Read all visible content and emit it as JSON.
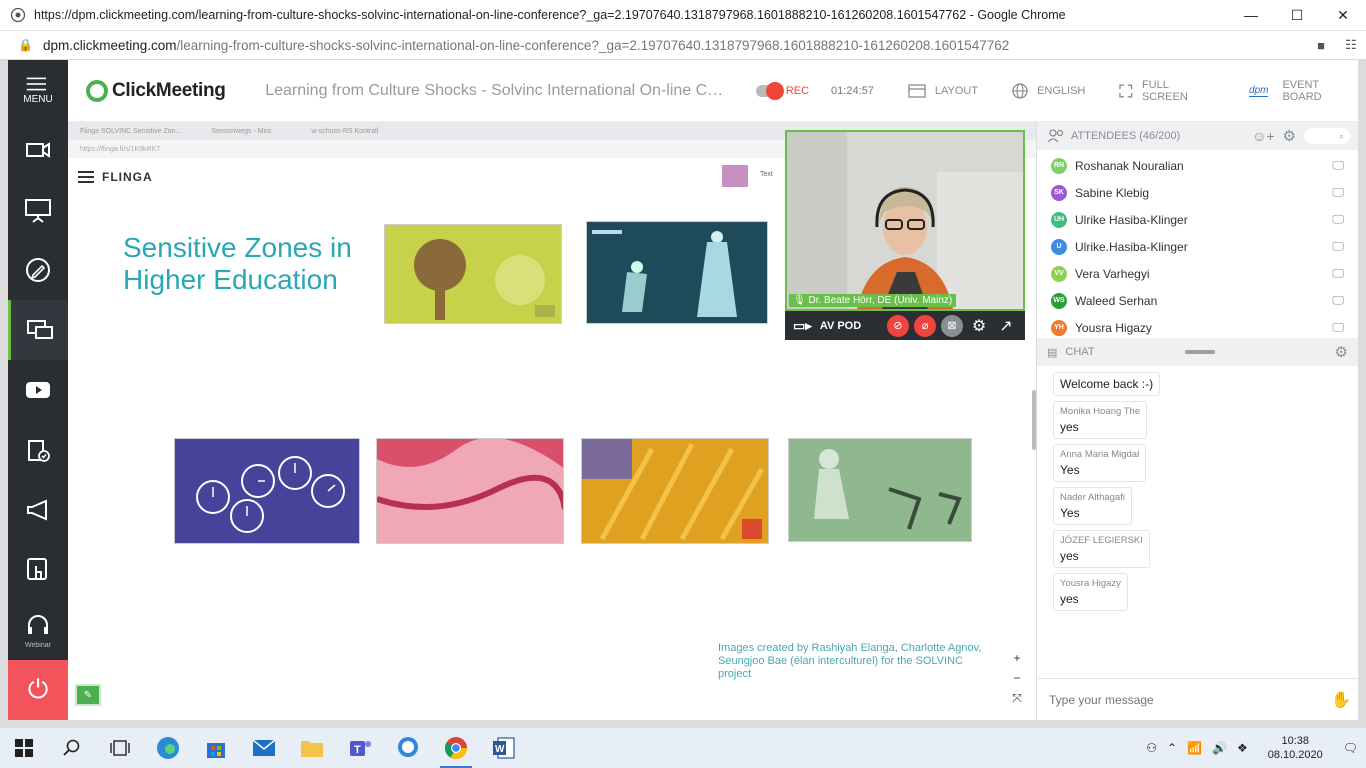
{
  "browser": {
    "title": "https://dpm.clickmeeting.com/learning-from-culture-shocks-solvinc-international-on-line-conference?_ga=2.19707640.1318797968.1601888210-161260208.1601547762 - Google Chrome",
    "url_host": "dpm.clickmeeting.com",
    "url_path": "/learning-from-culture-shocks-solvinc-international-on-line-conference?_ga=2.19707640.1318797968.1601888210-161260208.1601547762"
  },
  "nav": {
    "menu_label": "MENU",
    "webinar_label": "Webinar"
  },
  "topbar": {
    "logo": "ClickMeeting",
    "event_title": "Learning from Culture Shocks - Solvinc International On-line Conference",
    "rec_label": "REC",
    "rec_time": "01:24:57",
    "layout": "LAYOUT",
    "language": "ENGLISH",
    "fullscreen": "FULL SCREEN",
    "eventboard": "EVENT BOARD",
    "eventboard_brand": "dpm"
  },
  "shared_screen": {
    "tab1": "Flinga SOLVINC Sensitive Zon...",
    "tab2": "Sensoriwegs - Miro",
    "tab3": "w-schuss-RS Kontrall",
    "url": "https://flinga.fi/s/1K9kRKT",
    "app_name": "FLINGA",
    "swatch_text": "Text",
    "slide_title": "Sensitive Zones in Higher Education",
    "credit": "Images created by Rashiyah Elanga, Charlotte Agnov, Seungjoo Bae (élan interculturel) for the SOLVINC project",
    "zoom_in": "+",
    "zoom_out": "−",
    "fit": "⤧"
  },
  "avpod": {
    "presenter": "Dr. Beate Hörr, DE (Univ. Mainz)",
    "label": "AV POD"
  },
  "attendees": {
    "header": "ATTENDEES (46/200)",
    "list": [
      {
        "initials": "RN",
        "name": "Roshanak Nouralian",
        "color": "#7fcf6a"
      },
      {
        "initials": "SK",
        "name": "Sabine Klebig",
        "color": "#9b59d0"
      },
      {
        "initials": "UH",
        "name": "Ulrike Hasiba-Klinger",
        "color": "#3fbf7f"
      },
      {
        "initials": "U",
        "name": "Ulrike.Hasiba-Klinger",
        "color": "#3b8ee0"
      },
      {
        "initials": "VV",
        "name": "Vera Varhegyi",
        "color": "#8ed04f"
      },
      {
        "initials": "WS",
        "name": "Waleed Serhan",
        "color": "#2e9e3a"
      },
      {
        "initials": "YH",
        "name": "Yousra Higazy",
        "color": "#f07a2e"
      }
    ]
  },
  "chat": {
    "header": "CHAT",
    "messages": [
      {
        "author": "",
        "text": "Welcome back :-)"
      },
      {
        "author": "Monika Hoang The",
        "text": "yes"
      },
      {
        "author": "Anna Maria Migdał",
        "text": "Yes"
      },
      {
        "author": "Nader Althagafi",
        "text": "Yes"
      },
      {
        "author": "JÓZEF LEGIERSKI",
        "text": "yes"
      },
      {
        "author": "Yousra Higazy",
        "text": "yes"
      }
    ],
    "placeholder": "Type your message"
  },
  "taskbar": {
    "time": "10:38",
    "date": "08.10.2020"
  },
  "colors": {
    "brand_green": "#6abf4b",
    "rec_red": "#f0443c",
    "nav_bg": "#2a2e33",
    "exit_red": "#f2545b"
  }
}
